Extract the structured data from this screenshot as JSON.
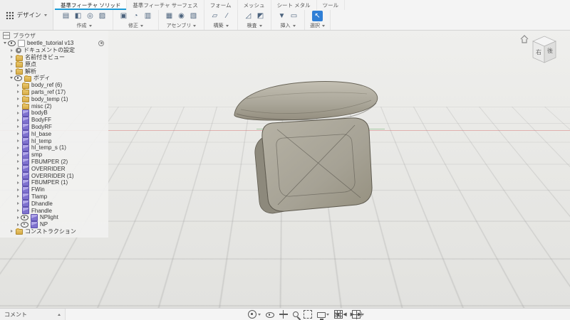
{
  "colors": {
    "accent": "#1b9bd7",
    "toolbar_bg": "#f4f4f4",
    "canvas_bg": "#e9e9e7",
    "select_active": "#2f7fd6",
    "body_fill": "#aba79a",
    "body_edge": "#5f5b50"
  },
  "toolbar": {
    "design_button": {
      "label": "デザイン"
    },
    "tabs": [
      {
        "label": "基準フィーチャ ソリッド",
        "active": true
      },
      {
        "label": "基準フィーチャ サーフェス",
        "active": false
      },
      {
        "label": "フォーム",
        "active": false
      },
      {
        "label": "メッシュ",
        "active": false
      },
      {
        "label": "シート メタル",
        "active": false
      },
      {
        "label": "ツール",
        "active": false
      }
    ],
    "groups": [
      {
        "label": "作成",
        "icons": [
          {
            "name": "new-body-icon",
            "glyph": "▤"
          },
          {
            "name": "extrude-icon",
            "glyph": "◧"
          },
          {
            "name": "revolve-icon",
            "glyph": "◎"
          },
          {
            "name": "sweep-icon",
            "glyph": "▨"
          }
        ]
      },
      {
        "label": "修正",
        "icons": [
          {
            "name": "press-pull-icon",
            "glyph": "▣"
          },
          {
            "name": "fillet-icon",
            "glyph": "◔"
          },
          {
            "name": "shell-icon",
            "glyph": "▥"
          }
        ]
      },
      {
        "label": "アセンブリ",
        "icons": [
          {
            "name": "new-component-icon",
            "glyph": "▦"
          },
          {
            "name": "joint-icon",
            "glyph": "◉"
          },
          {
            "name": "rigid-group-icon",
            "glyph": "▧"
          }
        ]
      },
      {
        "label": "構築",
        "icons": [
          {
            "name": "construct-plane-icon",
            "glyph": "▱"
          },
          {
            "name": "construct-axis-icon",
            "glyph": "∕"
          }
        ]
      },
      {
        "label": "検査",
        "icons": [
          {
            "name": "measure-icon",
            "glyph": "◿"
          },
          {
            "name": "section-analysis-icon",
            "glyph": "◩"
          }
        ]
      },
      {
        "label": "挿入",
        "icons": [
          {
            "name": "insert-mesh-icon",
            "glyph": "▼"
          },
          {
            "name": "decal-icon",
            "glyph": "▭"
          }
        ]
      },
      {
        "label": "選択",
        "icons": [
          {
            "name": "select-icon",
            "glyph": "↖",
            "active": true
          }
        ]
      }
    ]
  },
  "viewcube": {
    "left_face": "右",
    "right_face": "後"
  },
  "browser": {
    "header": "ブラウザ",
    "rows": [
      {
        "label": "beetle_tutorial v13",
        "icon": "doc",
        "level": 0,
        "expanded": true,
        "eye": true,
        "badge": true
      },
      {
        "label": "ドキュメントの設定",
        "icon": "gear",
        "level": 1,
        "expanded": false
      },
      {
        "label": "名前付きビュー",
        "icon": "folder",
        "level": 1,
        "expanded": false
      },
      {
        "label": "原点",
        "icon": "folder",
        "level": 1,
        "expanded": false
      },
      {
        "label": "解析",
        "icon": "folder",
        "level": 1,
        "expanded": false
      },
      {
        "label": "ボディ",
        "icon": "folder",
        "level": 1,
        "expanded": true,
        "eye": true
      },
      {
        "label": "body_ref (6)",
        "icon": "folder",
        "level": 2,
        "expanded": false
      },
      {
        "label": "parts_ref (17)",
        "icon": "folder",
        "level": 2,
        "expanded": false
      },
      {
        "label": "body_temp (1)",
        "icon": "folder",
        "level": 2,
        "expanded": false
      },
      {
        "label": "misc (2)",
        "icon": "folder",
        "level": 2,
        "expanded": false
      },
      {
        "label": "bodyB",
        "icon": "cube",
        "level": 2,
        "expanded": false
      },
      {
        "label": "BodyFF",
        "icon": "cube",
        "level": 2,
        "expanded": false
      },
      {
        "label": "BodyRF",
        "icon": "cube",
        "level": 2,
        "expanded": false
      },
      {
        "label": "hl_base",
        "icon": "cube",
        "level": 2,
        "expanded": false
      },
      {
        "label": "hl_temp",
        "icon": "cube",
        "level": 2,
        "expanded": false
      },
      {
        "label": "hl_temp_s (1)",
        "icon": "cube",
        "level": 2,
        "expanded": false
      },
      {
        "label": "smp",
        "icon": "cube",
        "level": 2,
        "expanded": false
      },
      {
        "label": "FBUMPER (2)",
        "icon": "cube",
        "level": 2,
        "expanded": false
      },
      {
        "label": "OVERRIDER",
        "icon": "cube",
        "level": 2,
        "expanded": false
      },
      {
        "label": "OVERRIDER (1)",
        "icon": "cube",
        "level": 2,
        "expanded": false
      },
      {
        "label": "FBUMPER (1)",
        "icon": "cube",
        "level": 2,
        "expanded": false
      },
      {
        "label": "FWin",
        "icon": "cube",
        "level": 2,
        "expanded": false
      },
      {
        "label": "Tlamp",
        "icon": "cube",
        "level": 2,
        "expanded": false
      },
      {
        "label": "Dhandle",
        "icon": "cube",
        "level": 2,
        "expanded": false
      },
      {
        "label": "Fhandle",
        "icon": "cube",
        "level": 2,
        "expanded": false
      },
      {
        "label": "NPlight",
        "icon": "cube",
        "level": 2,
        "expanded": false,
        "eye": true
      },
      {
        "label": "NP",
        "icon": "cube",
        "level": 2,
        "expanded": false,
        "eye": true
      },
      {
        "label": "コンストラクション",
        "icon": "folder",
        "level": 1,
        "expanded": false
      }
    ]
  },
  "bottombar": {
    "comment_label": "コメント",
    "nav_items": [
      {
        "name": "orbit",
        "caret": true
      },
      {
        "name": "look-at",
        "caret": false
      },
      {
        "name": "pan",
        "caret": false
      },
      {
        "name": "zoom",
        "caret": false
      },
      {
        "name": "fit",
        "caret": false
      },
      {
        "name": "display-settings",
        "caret": true
      },
      {
        "name": "grid-settings",
        "caret": true
      },
      {
        "name": "viewports",
        "caret": true
      }
    ],
    "play_controls": [
      {
        "name": "go-to-start",
        "glyph": "|◀"
      },
      {
        "name": "step-back",
        "glyph": "◀"
      },
      {
        "name": "play",
        "glyph": "▶"
      },
      {
        "name": "step-forward",
        "glyph": "▶|"
      }
    ]
  }
}
